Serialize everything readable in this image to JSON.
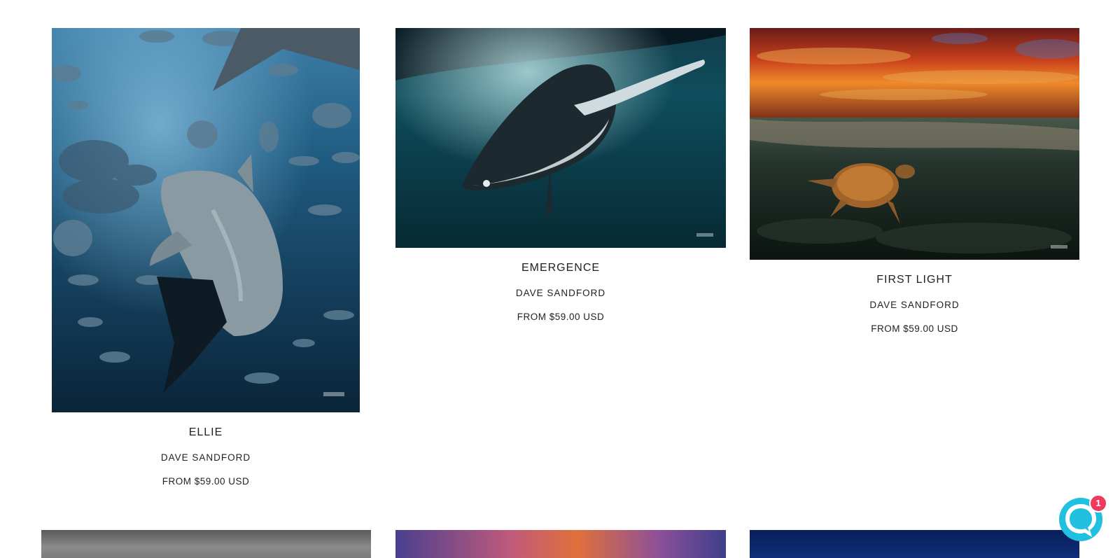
{
  "products": [
    {
      "id": "ellie",
      "title": "ELLIE",
      "artist": "DAVE SANDFORD",
      "price": "FROM $59.00 USD",
      "image_icon": "shark-photo"
    },
    {
      "id": "emergence",
      "title": "EMERGENCE",
      "artist": "DAVE SANDFORD",
      "price": "FROM $59.00 USD",
      "image_icon": "whale-photo"
    },
    {
      "id": "first_light",
      "title": "FIRST LIGHT",
      "artist": "DAVE SANDFORD",
      "price": "FROM $59.00 USD",
      "image_icon": "turtle-photo"
    }
  ],
  "chat": {
    "badge_count": "1",
    "icon": "chat-bubble-icon",
    "accent": "#22c0e0",
    "badge_color": "#ef3a5d"
  }
}
